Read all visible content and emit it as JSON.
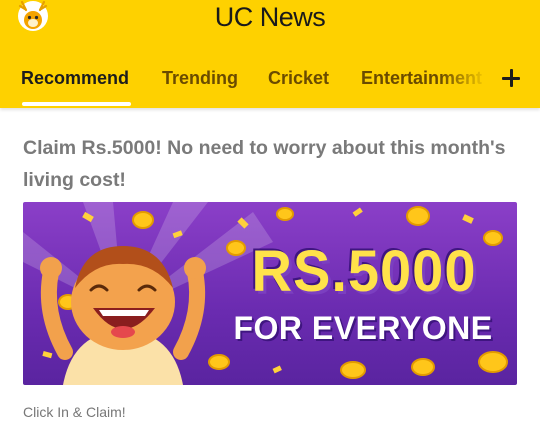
{
  "header": {
    "brand": "UC News",
    "tabs": [
      {
        "label": "Recommend",
        "active": true
      },
      {
        "label": "Trending",
        "active": false
      },
      {
        "label": "Cricket",
        "active": false
      },
      {
        "label": "Entertainment",
        "active": false
      }
    ],
    "add_icon": "plus-icon",
    "logo_icon": "uc-squirrel-logo-icon"
  },
  "article": {
    "title": "Claim Rs.5000! No need to worry about this month's living cost!",
    "banner_line_1": "RS.5000",
    "banner_line_2": "FOR EVERYONE",
    "subtitle": "Click In & Claim!"
  },
  "colors": {
    "header_bg": "#fed100",
    "banner_bg": "#7a35bd",
    "banner_gold": "#ffe24a"
  }
}
